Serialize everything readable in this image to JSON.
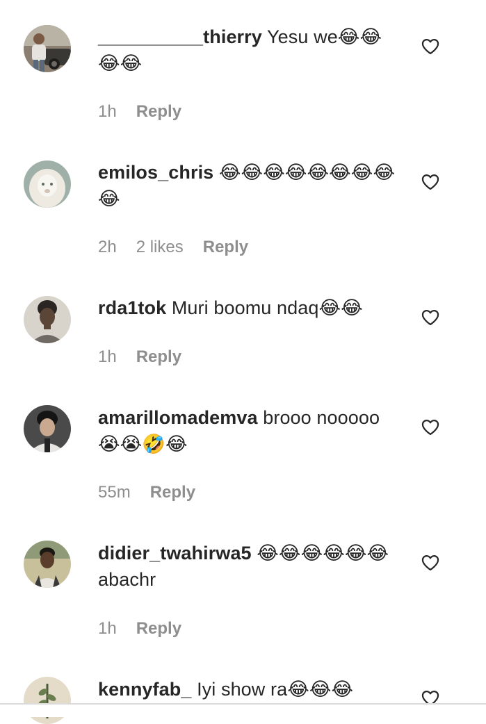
{
  "comments": [
    {
      "username": "__________thierry",
      "text": "Yesu we😂😂😂😂",
      "time": "1h",
      "likes": "",
      "reply_label": "Reply",
      "avatar_icon": "avatar-man-with-car"
    },
    {
      "username": "emilos_chris",
      "text": "😂😂😂😂😂😂😂😂😂",
      "time": "2h",
      "likes": "2 likes",
      "reply_label": "Reply",
      "avatar_icon": "avatar-white-lion"
    },
    {
      "username": "rda1tok",
      "text": "Muri boomu ndaq😂😂",
      "time": "1h",
      "likes": "",
      "reply_label": "Reply",
      "avatar_icon": "avatar-woman-portrait"
    },
    {
      "username": "amarillomademva",
      "text": "brooo nooooo😭😭🤣😂",
      "time": "55m",
      "likes": "",
      "reply_label": "Reply",
      "avatar_icon": "avatar-man-portrait"
    },
    {
      "username": "didier_twahirwa5",
      "text": "😂😂😂😂😂😂abachr",
      "time": "1h",
      "likes": "",
      "reply_label": "Reply",
      "avatar_icon": "avatar-young-man"
    },
    {
      "username": "kennyfab_",
      "text": "Iyi show ra😂😂😂",
      "time": "",
      "likes": "",
      "reply_label": "",
      "avatar_icon": "avatar-plant"
    }
  ],
  "colors": {
    "text": "#262626",
    "meta": "#8e8e8e",
    "heart_stroke": "#262626"
  }
}
